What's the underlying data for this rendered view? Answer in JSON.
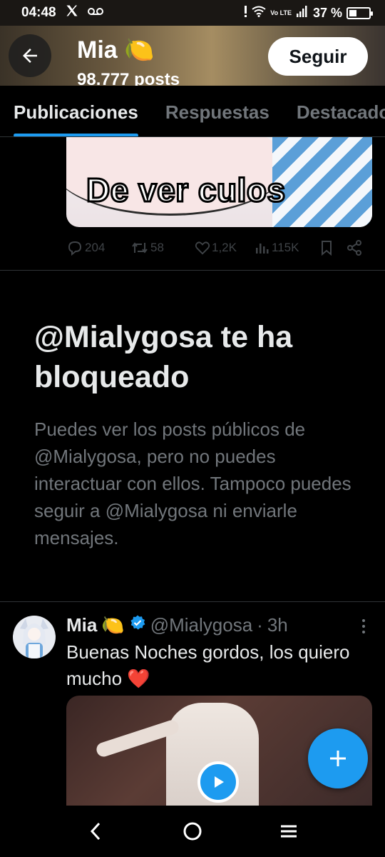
{
  "status_bar": {
    "time": "04:48",
    "network_label": "Vo LTE",
    "network_gen": "4G",
    "battery": "37 %",
    "battery_level": 0.37
  },
  "header": {
    "name": "Mia",
    "name_emoji": "🍋",
    "subtitle": "98.777 posts",
    "follow_label": "Seguir"
  },
  "tabs": [
    {
      "label": "Publicaciones",
      "active": true
    },
    {
      "label": "Respuestas",
      "active": false
    },
    {
      "label": "Destacados",
      "active": false
    }
  ],
  "previous_post": {
    "image_caption": "De ver culos",
    "replies": "204",
    "reposts": "58",
    "likes": "1,2K",
    "views": "115K"
  },
  "blocked_notice": {
    "title": "@Mialygosa te ha bloqueado",
    "body": "Puedes ver los posts públicos de @Mialygosa, pero no puedes interactuar con ellos. Tampoco puedes seguir a @Mialygosa ni enviarle mensajes."
  },
  "post": {
    "author_name": "Mia",
    "author_emoji": "🍋",
    "verified": true,
    "handle": "@Mialygosa",
    "separator": "·",
    "time": "3h",
    "text": "Buenas Noches gordos, los quiero mucho",
    "text_emoji": "❤️"
  },
  "colors": {
    "accent": "#1d9bf0",
    "background": "#000000",
    "primary_text": "#e7e9ea",
    "secondary_text": "#71767b",
    "divider": "#2f3336"
  },
  "icons": [
    "back-arrow-icon",
    "x-logo-icon",
    "voicemail-icon",
    "wifi-icon",
    "signal-icon",
    "battery-icon",
    "reply-icon",
    "repost-icon",
    "like-icon",
    "views-icon",
    "bookmark-icon",
    "share-icon",
    "verified-badge-icon",
    "more-icon",
    "play-icon",
    "compose-plus-icon",
    "nav-back-icon",
    "nav-home-icon",
    "nav-menu-icon"
  ]
}
